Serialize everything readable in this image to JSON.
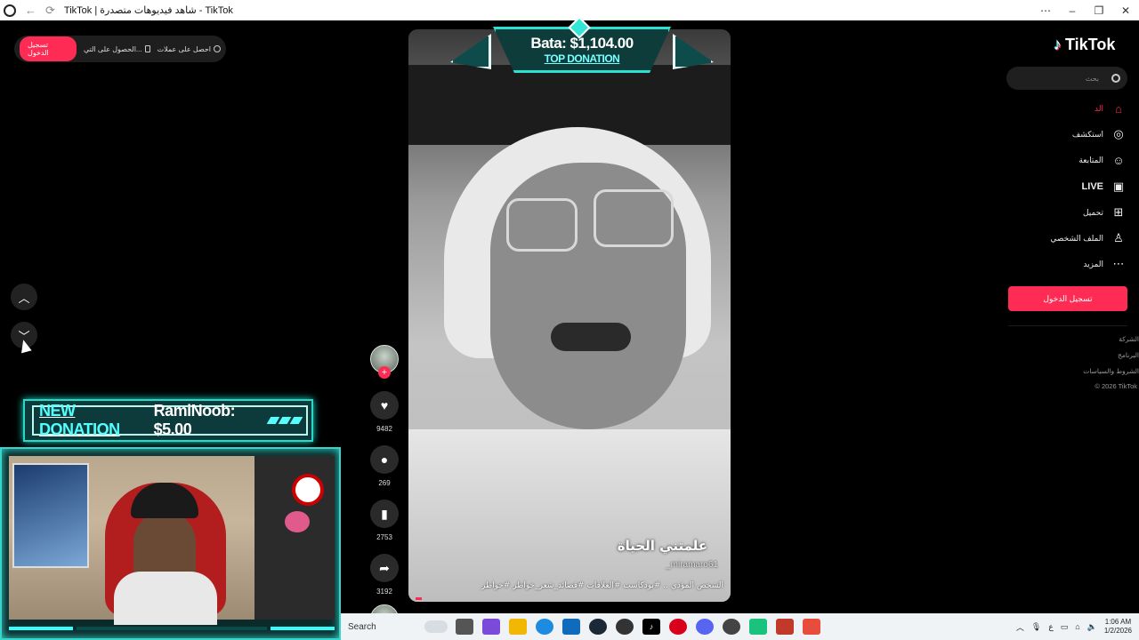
{
  "browser": {
    "title": "TikTok | شاهد فيديوهات متصدرة - TikTok",
    "back_icon": "back-arrow-icon",
    "reload_icon": "reload-icon"
  },
  "topbar": {
    "login_label": "تسجيل الدخول",
    "get_app_label": "الحصول على التي...",
    "get_coins_label": "احصل على عملات"
  },
  "overlay": {
    "donation_tag": "NEW DONATION",
    "donation_text": "RamiNoob: $5.00",
    "top_amount": "Bata: $1,104.00",
    "top_label": "TOP DONATION"
  },
  "video": {
    "caption": "علمتني الحياة",
    "handle": "_miramaro61",
    "description": "الشخص المؤذي .. #بودكاست #العلاقات #قصائد_شعر_خواطر #خواطر",
    "progress": 0.02
  },
  "actions": {
    "likes": "9482",
    "comments": "269",
    "saves": "2753",
    "shares": "3192",
    "follow_plus": "+"
  },
  "sidebar": {
    "logo": "TikTok",
    "search_placeholder": "بحث",
    "items": [
      {
        "label": "الد",
        "icon": "home-icon"
      },
      {
        "label": "استكشف",
        "icon": "compass-icon"
      },
      {
        "label": "المتابعة",
        "icon": "follow-icon"
      },
      {
        "label": "LIVE",
        "icon": "live-icon"
      },
      {
        "label": "تحميل",
        "icon": "upload-icon"
      },
      {
        "label": "الملف الشخصي",
        "icon": "profile-icon"
      },
      {
        "label": "المزيد",
        "icon": "more-icon"
      }
    ],
    "login_button": "تسجيل الدخول",
    "footer": [
      "الشركة",
      "البرنامج",
      "الشروط والسياسات",
      "© 2026 TikTok"
    ]
  },
  "taskbar": {
    "search_label": "Search",
    "time": "1:06 AM",
    "date": "1/2/2026",
    "lang": "ع"
  },
  "colors": {
    "accent": "#fe2c55",
    "overlay_teal": "#2ee0d2"
  }
}
